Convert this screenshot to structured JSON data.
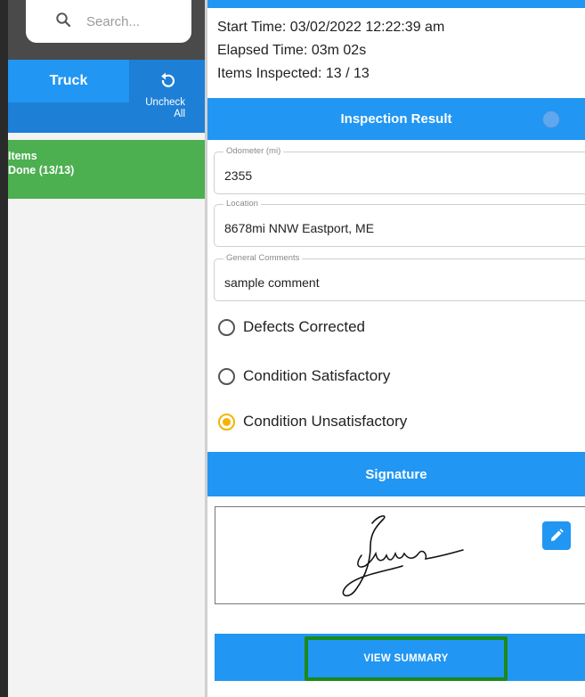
{
  "sidebar": {
    "search": {
      "placeholder": "Search..."
    },
    "tab_label": "Truck",
    "uncheck_line1": "Uncheck",
    "uncheck_line2": "All",
    "items_line1": "Items",
    "items_line2": "Done (13/13)"
  },
  "inspection": {
    "start_time": "Start Time: 03/02/2022 12:22:39 am",
    "elapsed_time": "Elapsed Time: 03m 02s",
    "items_inspected": "Items Inspected: 13 / 13",
    "result_header": "Inspection Result",
    "fields": [
      {
        "label": "Odometer (mi)",
        "value": "2355"
      },
      {
        "label": "Location",
        "value": "8678mi NNW Eastport, ME"
      },
      {
        "label": "General Comments",
        "value": "sample comment"
      }
    ],
    "options": [
      {
        "label": "Defects Corrected",
        "selected": false
      },
      {
        "label": "Condition Satisfactory",
        "selected": false
      },
      {
        "label": "Condition Unsatisfactory",
        "selected": true
      }
    ],
    "signature_header": "Signature",
    "signature_text": "James",
    "summary_button": "VIEW SUMMARY"
  },
  "icons": {
    "search": "search-icon",
    "uncheck": "undo-icon",
    "edit": "pencil-icon"
  },
  "colors": {
    "primary_blue": "#2196f3",
    "green_done": "#4caf50",
    "selected_radio": "#f4b400",
    "highlight_border": "#1a8a1a"
  }
}
